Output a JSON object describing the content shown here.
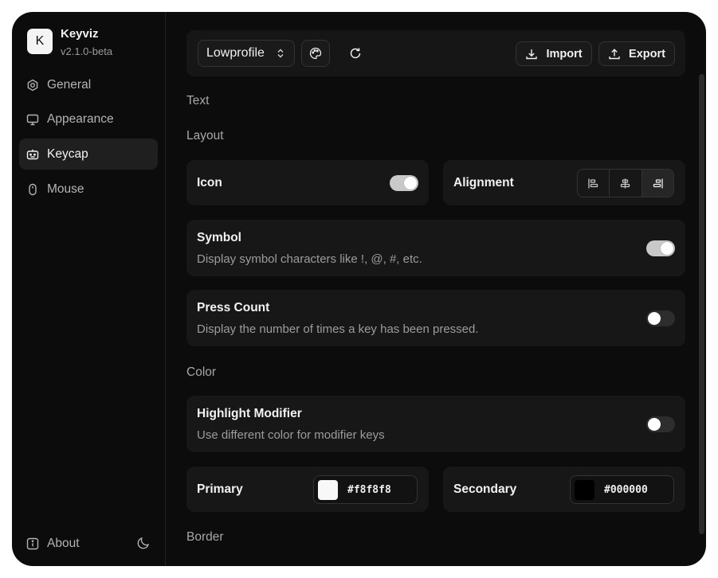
{
  "app": {
    "logo_letter": "K",
    "name": "Keyviz",
    "version": "v2.1.0-beta"
  },
  "sidebar": {
    "items": [
      {
        "label": "General",
        "icon": "gear-icon",
        "active": false
      },
      {
        "label": "Appearance",
        "icon": "monitor-icon",
        "active": false
      },
      {
        "label": "Keycap",
        "icon": "keycap-icon",
        "active": true
      },
      {
        "label": "Mouse",
        "icon": "mouse-icon",
        "active": false
      }
    ],
    "about_label": "About",
    "theme_icon": "moon-icon"
  },
  "toolbar": {
    "preset_value": "Lowprofile",
    "import_label": "Import",
    "export_label": "Export"
  },
  "sections": {
    "text": "Text",
    "layout": "Layout",
    "color": "Color",
    "border": "Border"
  },
  "layout": {
    "icon": {
      "title": "Icon",
      "enabled": true
    },
    "alignment": {
      "title": "Alignment",
      "options": [
        "left",
        "center",
        "right"
      ],
      "selected": "right"
    },
    "symbol": {
      "title": "Symbol",
      "description": "Display symbol characters like !, @, #, etc.",
      "enabled": true
    },
    "press_count": {
      "title": "Press Count",
      "description": "Display the number of times a key has been pressed.",
      "enabled": false
    }
  },
  "color": {
    "highlight_modifier": {
      "title": "Highlight Modifier",
      "description": "Use different color for modifier keys",
      "enabled": false
    },
    "primary": {
      "label": "Primary",
      "hex": "#f8f8f8"
    },
    "secondary": {
      "label": "Secondary",
      "hex": "#000000"
    }
  }
}
